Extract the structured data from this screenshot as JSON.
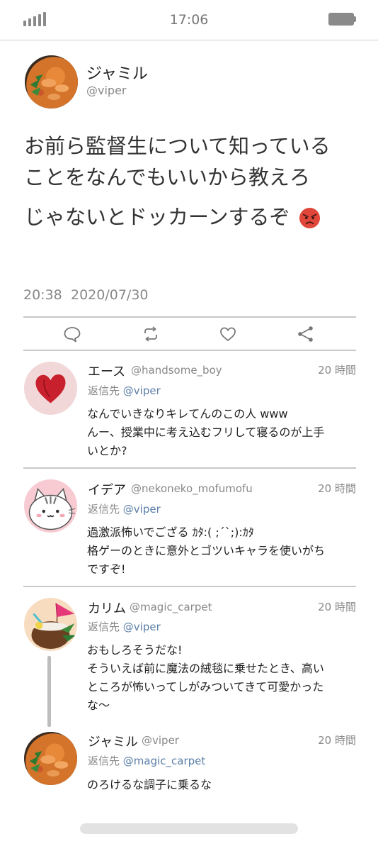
{
  "status": {
    "time": "17:06",
    "signal_icon": "signal-bars-icon",
    "battery_icon": "battery-icon"
  },
  "main_tweet": {
    "name": "ジャミル",
    "handle": "@viper",
    "text_line1": "お前ら監督生について知っている\nことをなんでもいいから教えろ",
    "text_line2": "じゃないとドッカーンするぞ",
    "emoji": "angry-face-emoji",
    "time": "20:38",
    "date": "2020/07/30"
  },
  "actions": [
    "reply-icon",
    "retweet-icon",
    "like-icon",
    "share-icon"
  ],
  "replies": [
    {
      "name": "エース",
      "handle": "@handsome_boy",
      "time": "20 時間",
      "reply_prefix": "返信先",
      "reply_to": "@viper",
      "body": "なんでいきなりキレてんのこの人 www\nんー、授業中に考え込むフリして寝るのが上手\nいとか?"
    },
    {
      "name": "イデア",
      "handle": "@nekoneko_mofumofu",
      "time": "20 時間",
      "reply_prefix": "返信先",
      "reply_to": "@viper",
      "body": "過激派怖いでござる ｶﾀ:( ;´`;):ｶﾀ\n格ゲーのときに意外とゴツいキャラを使いがち\nですぞ!"
    },
    {
      "name": "カリム",
      "handle": "@magic_carpet",
      "time": "20 時間",
      "reply_prefix": "返信先",
      "reply_to": "@viper",
      "body": "おもしろそうだな!\nそういえば前に魔法の絨毯に乗せたとき、高い\nところが怖いってしがみついてきて可愛かった\nな〜"
    },
    {
      "name": "ジャミル",
      "handle": "@viper",
      "time": "20 時間",
      "reply_prefix": "返信先",
      "reply_to": "@magic_carpet",
      "body": "のろけるな調子に乗るな"
    }
  ]
}
